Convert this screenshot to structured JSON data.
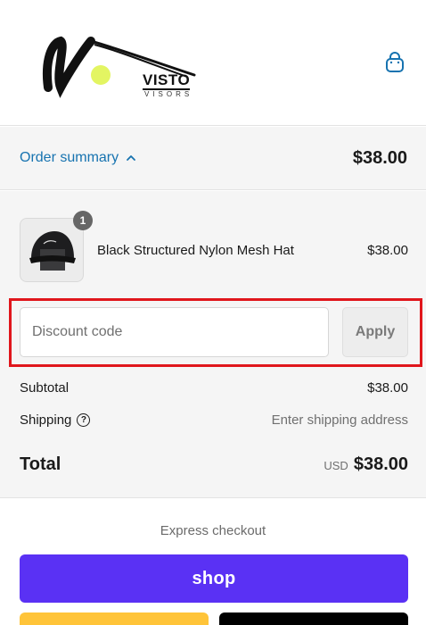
{
  "brand": {
    "name": "VISTO",
    "tagline": "VISORS"
  },
  "summary": {
    "toggle_label": "Order summary",
    "total": "$38.00"
  },
  "items": [
    {
      "name": "Black Structured Nylon Mesh Hat",
      "price": "$38.00",
      "quantity": "1"
    }
  ],
  "discount": {
    "placeholder": "Discount code",
    "apply_label": "Apply"
  },
  "totals": {
    "subtotal_label": "Subtotal",
    "subtotal_value": "$38.00",
    "shipping_label": "Shipping",
    "shipping_value": "Enter shipping address",
    "total_label": "Total",
    "currency": "USD",
    "total_value": "$38.00"
  },
  "express": {
    "label": "Express checkout",
    "shop_label": "shop"
  },
  "colors": {
    "link": "#1773b0",
    "highlight": "#e0161c",
    "shop_pay": "#5a31f4",
    "paypal": "#ffc439",
    "dark_pay": "#000000",
    "logo_dot": "#e3f562"
  }
}
